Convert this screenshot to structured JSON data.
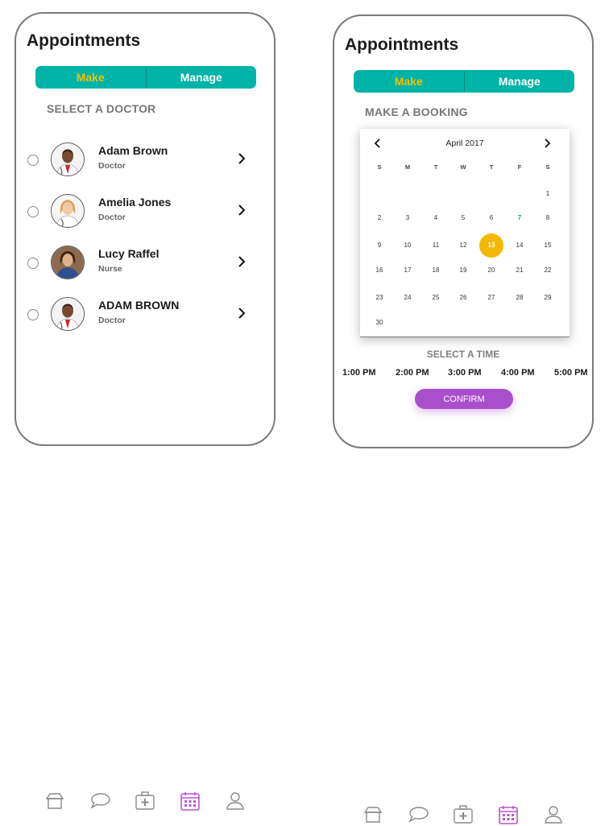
{
  "left": {
    "title": "Appointments",
    "segments": {
      "make": "Make",
      "manage": "Manage"
    },
    "section_label": "SELECT A DOCTOR",
    "doctors": [
      {
        "name": "Adam Brown",
        "role": "Doctor"
      },
      {
        "name": "Amelia Jones",
        "role": "Doctor"
      },
      {
        "name": "Lucy Raffel",
        "role": "Nurse"
      },
      {
        "name": "ADAM BROWN",
        "role": "Doctor"
      }
    ]
  },
  "right": {
    "title": "Appointments",
    "segments": {
      "make": "Make",
      "manage": "Manage"
    },
    "section_label": "MAKE A BOOKING",
    "calendar": {
      "month": "April 2017",
      "weekdays": [
        "S",
        "M",
        "T",
        "W",
        "T",
        "F",
        "S"
      ],
      "days": [
        "1",
        "2",
        "3",
        "4",
        "5",
        "6",
        "7",
        "8",
        "9",
        "10",
        "11",
        "12",
        "13",
        "14",
        "15",
        "16",
        "17",
        "18",
        "19",
        "20",
        "21",
        "22",
        "23",
        "24",
        "25",
        "26",
        "27",
        "28",
        "29",
        "30"
      ],
      "today": "7",
      "selected": "13"
    },
    "time_label": "SELECT A TIME",
    "times": [
      "1:00 PM",
      "2:00 PM",
      "3:00 PM",
      "4:00 PM",
      "5:00 PM"
    ],
    "confirm": "CONFIRM"
  },
  "colors": {
    "teal": "#00b3a7",
    "yellow": "#f3c200",
    "purple": "#a94fcc",
    "active_tab": "#b855d6"
  },
  "tabbar_icons": [
    "home-icon",
    "chat-icon",
    "medical-kit-icon",
    "calendar-icon",
    "profile-icon"
  ]
}
